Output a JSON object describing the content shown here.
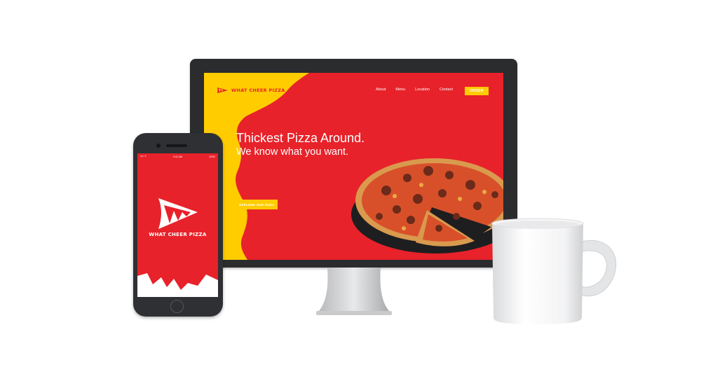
{
  "desktop_site": {
    "brand": "WHAT CHEER PIZZA",
    "nav": [
      "About",
      "Menu",
      "Location",
      "Contact"
    ],
    "order_label": "ORDER",
    "hero_title": "Thickest Pizza Around.",
    "hero_subtitle": "We know what you want.",
    "explore_label": "EXPLORE OUR PIZZA"
  },
  "phone_app": {
    "status_time": "9:41 AM",
    "status_battery": "100%",
    "brand": "WHAT CHEER PIZZA"
  },
  "colors": {
    "brand_red": "#e8222a",
    "accent_yellow": "#ffcc00",
    "device_dark": "#2b2c2e"
  },
  "icons": [
    "pizza-slice-logo-icon",
    "home-button-icon"
  ]
}
